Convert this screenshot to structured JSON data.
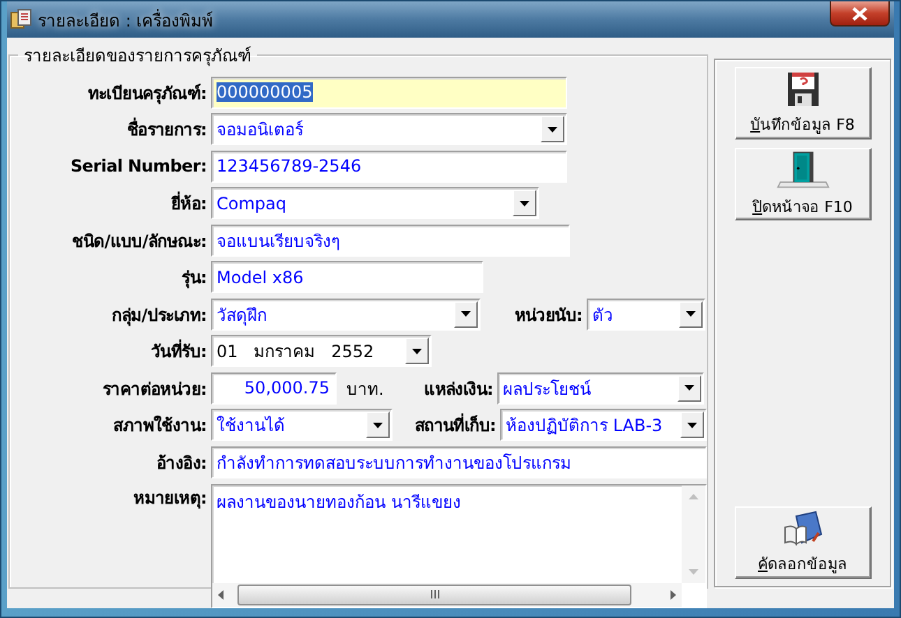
{
  "window": {
    "title": "รายละเอียด : เครื่องพิมพ์"
  },
  "group": {
    "title": "รายละเอียดของรายการครุภัณฑ์"
  },
  "rows": [
    {
      "fields": [
        {
          "label": "ทะเบียนครุภัณฑ์:",
          "kind": "text",
          "value": "000000005",
          "focused": true
        }
      ]
    },
    {
      "fields": [
        {
          "label": "ชื่อรายการ:",
          "kind": "combo",
          "value": "จอมอนิเตอร์"
        }
      ]
    },
    {
      "fields": [
        {
          "label": "Serial Number:",
          "kind": "text",
          "value": "123456789-2546"
        }
      ]
    },
    {
      "fields": [
        {
          "label": "ยี่ห้อ:",
          "kind": "combo",
          "value": "Compaq"
        }
      ]
    },
    {
      "fields": [
        {
          "label": "ชนิด/แบบ/ลักษณะ:",
          "kind": "text",
          "value": "จอแบนเรียบจริงๆ"
        }
      ]
    },
    {
      "fields": [
        {
          "label": "รุ่น:",
          "kind": "text",
          "value": "Model x86"
        }
      ]
    },
    {
      "fields": [
        {
          "label": "กลุ่ม/ประเภท:",
          "kind": "combo",
          "value": "วัสดุฝึก"
        },
        {
          "label": "หน่วยนับ:",
          "kind": "combo",
          "value": "ตัว"
        }
      ]
    },
    {
      "fields": [
        {
          "label": "วันที่รับ:",
          "kind": "date",
          "value": "01   มกราคม   2552"
        }
      ]
    },
    {
      "fields": [
        {
          "label": "ราคาต่อหน่วย:",
          "kind": "number",
          "value": "50,000.75",
          "suffix": "บาท."
        },
        {
          "label": "แหล่งเงิน:",
          "kind": "combo",
          "value": "ผลประโยชน์"
        }
      ]
    },
    {
      "fields": [
        {
          "label": "สภาพใช้งาน:",
          "kind": "combo",
          "value": "ใช้งานได้"
        },
        {
          "label": "สถานที่เก็บ:",
          "kind": "combo",
          "value": "ห้องปฏิบัติการ LAB-3"
        }
      ]
    },
    {
      "fields": [
        {
          "label": "อ้างอิง:",
          "kind": "text",
          "value": "กำลังทำการทดสอบระบบการทำงานของโปรแกรม"
        }
      ]
    },
    {
      "fields": [
        {
          "label": "หมายเหตุ:",
          "kind": "memo",
          "value": "ผลงานของนายทองก้อน นารีแขยง"
        }
      ]
    }
  ],
  "buttons": [
    {
      "label": "บันทึกข้อมูล F8",
      "kind": "save"
    },
    {
      "label": "ปิดหน้าจอ F10",
      "kind": "exit"
    },
    {
      "label": "คัดลอกข้อมูล",
      "kind": "copy"
    }
  ]
}
